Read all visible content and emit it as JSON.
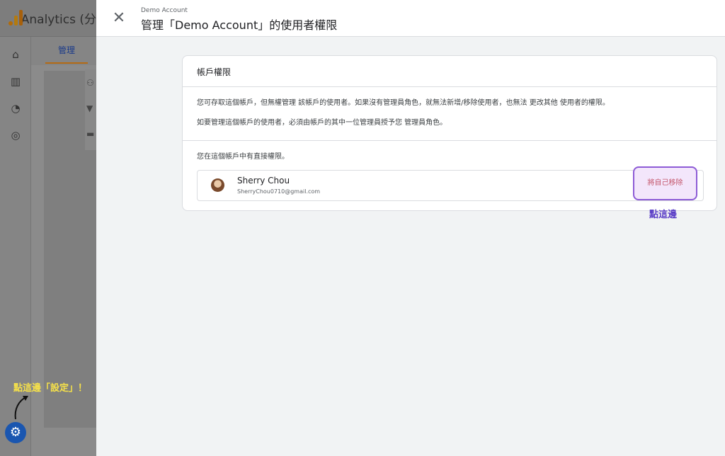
{
  "background_app": {
    "title": "Analytics (分",
    "tab_label": "管理",
    "rail_icons": [
      "home-icon",
      "reports-icon",
      "explore-icon",
      "advertising-icon"
    ],
    "column_icons": [
      "people-icon",
      "filter-icon",
      "trash-icon"
    ]
  },
  "annotations": {
    "settings_hint": "點這邊「設定」！",
    "remove_hint": "點這邊"
  },
  "dialog": {
    "account_name": "Demo Account",
    "title": "管理「Demo Account」的使用者權限",
    "card": {
      "title": "帳戶權限",
      "paragraph1": "您可存取這個帳戶，但無權管理 該帳戶的使用者。如果沒有管理員角色，就無法新增/移除使用者，也無法 更改其他 使用者的權限。",
      "paragraph2": "如要管理這個帳戶的使用者，必須由帳戶的其中一位管理員授予您 管理員角色。",
      "paragraph3": "您在這個帳戶中有直接權限。"
    },
    "user": {
      "name": "Sherry Chou",
      "email": "SherryChou0710@gmail.com"
    },
    "remove_button": "將自己移除"
  },
  "colors": {
    "accent_blue": "#1a56b0",
    "highlight_border": "#8d5bd6",
    "annotation_yellow": "#f5e04a",
    "annotation_purple": "#5a3ec6"
  }
}
